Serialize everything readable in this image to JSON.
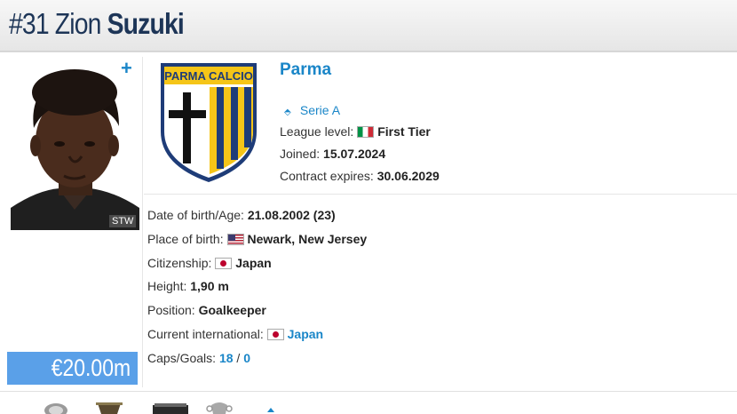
{
  "header": {
    "number": "#31",
    "first_name": "Zion",
    "last_name": "Suzuki"
  },
  "photo": {
    "credit": "STW",
    "add_label": "+"
  },
  "market_value": "€20.00m",
  "club": {
    "crest_text": "PARMA CALCIO",
    "name": "Parma",
    "league": "Serie A",
    "league_level_label": "League level:",
    "league_level_value": "First Tier",
    "joined_label": "Joined:",
    "joined_value": "15.07.2024",
    "contract_label": "Contract expires:",
    "contract_value": "30.06.2029"
  },
  "details": {
    "dob_label": "Date of birth/Age:",
    "dob_value": "21.08.2002 (23)",
    "pob_label": "Place of birth:",
    "pob_value": "Newark, New Jersey",
    "citizenship_label": "Citizenship:",
    "citizenship_value": "Japan",
    "height_label": "Height:",
    "height_value": "1,90 m",
    "position_label": "Position:",
    "position_value": "Goalkeeper",
    "international_label": "Current international:",
    "international_value": "Japan",
    "caps_label": "Caps/Goals:",
    "caps_value": "18",
    "caps_separator": "/",
    "goals_value": "0"
  },
  "colors": {
    "accent": "#1a86c8",
    "header_text": "#1d3557",
    "value_box": "#5aa0e8",
    "crest_yellow": "#f5c518",
    "crest_blue": "#1e3c78"
  },
  "icons": [
    "plus-icon",
    "league-icon",
    "flag-italy-icon",
    "flag-usa-icon",
    "flag-japan-icon",
    "trophy-icon"
  ]
}
